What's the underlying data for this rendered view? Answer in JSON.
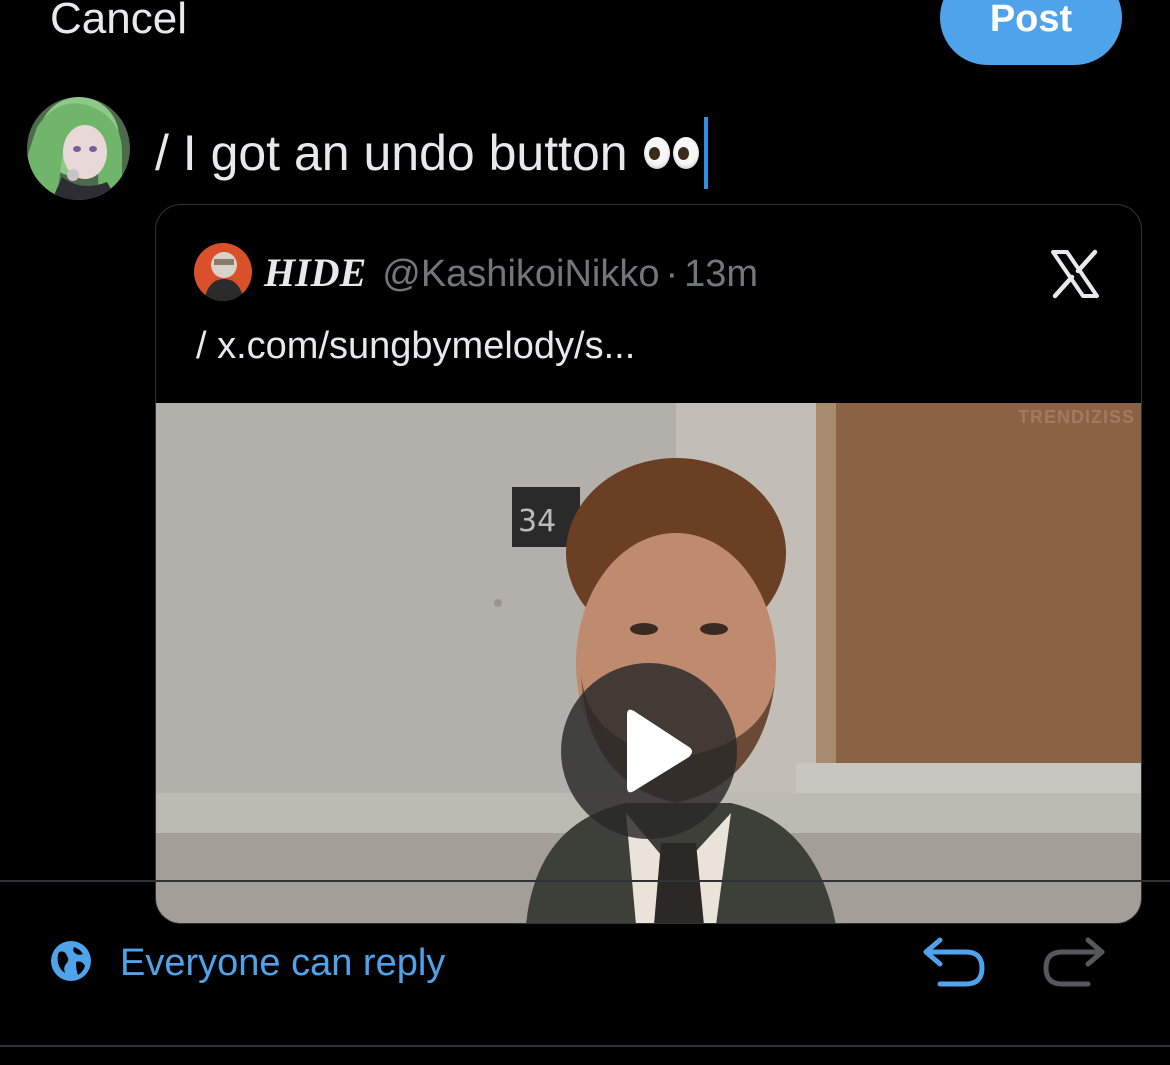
{
  "header": {
    "cancel_label": "Cancel",
    "post_label": "Post"
  },
  "compose": {
    "text": "/ I got an undo button",
    "emoji_icon": "eyes-emoji"
  },
  "quoted_post": {
    "display_name": "HIDE",
    "handle": "@KashikoiNikko",
    "separator": "·",
    "time": "13m",
    "body": "/ x.com/sungbymelody/s...",
    "close_icon": "x-logo-icon",
    "media": {
      "room_sign": "34",
      "watermark": "TRENDIZISS",
      "play_icon": "play-icon"
    }
  },
  "footer": {
    "reply_setting_label": "Everyone can reply",
    "globe_icon": "globe-icon",
    "undo_icon": "undo-icon",
    "redo_icon": "redo-icon"
  },
  "colors": {
    "accent": "#4ea3ea",
    "background": "#000000",
    "muted": "#71767b",
    "border": "#2f3336"
  }
}
